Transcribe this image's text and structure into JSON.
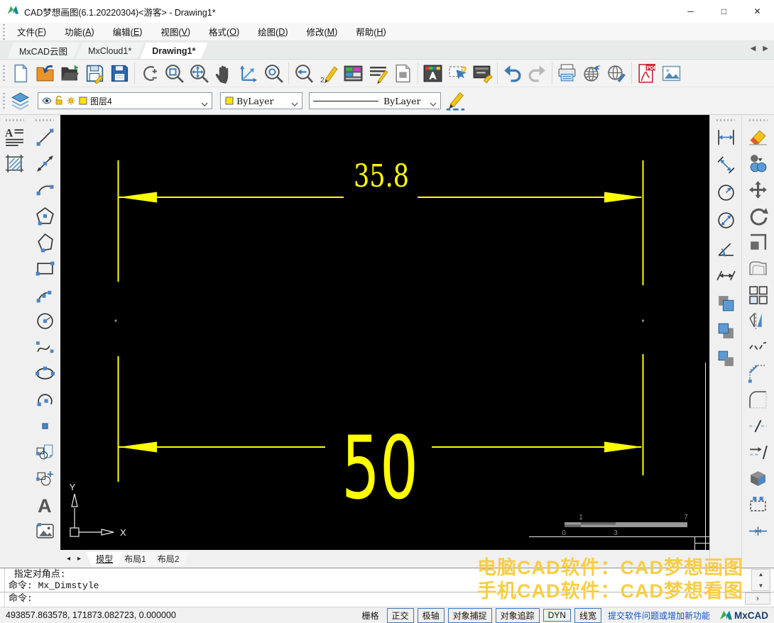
{
  "window": {
    "title": "CAD梦想画图(6.1.20220304)<游客> - Drawing1*",
    "minimize": "─",
    "maximize": "□",
    "close": "✕"
  },
  "menu": {
    "items": [
      "文件(F)",
      "功能(A)",
      "编辑(E)",
      "视图(V)",
      "格式(O)",
      "绘图(D)",
      "修改(M)",
      "帮助(H)"
    ]
  },
  "doc_tabs": {
    "tabs": [
      "MxCAD云图",
      "MxCloud1*",
      "Drawing1*"
    ],
    "active_index": 2,
    "scroll_left": "◀",
    "scroll_right": "▶"
  },
  "toolbar_main": {
    "icons": [
      "new-file",
      "open-dwg",
      "open-file",
      "save",
      "save-as",
      "zoom-scale",
      "zoom-window",
      "zoom-extents",
      "pan",
      "axes",
      "zoom-object",
      "zoom-previous",
      "draw-pencil",
      "layer-manager",
      "linetype-manager",
      "page-setup",
      "text-style",
      "selection-settings",
      "style-brush",
      "undo",
      "redo",
      "print",
      "publish-web",
      "web-edit",
      "export-pdf",
      "insert-image"
    ],
    "groups": "5,6,5,3,2,3,2"
  },
  "properties": {
    "layer": "图层4",
    "color": "ByLayer",
    "linetype": "ByLayer"
  },
  "left_toolbar": {
    "col1": [
      "mtext",
      "hatch"
    ],
    "col2": [
      "line",
      "xline",
      "arc",
      "polygon",
      "polyline",
      "rectangle",
      "pline-arc",
      "circle",
      "spline",
      "ellipse",
      "arc-cse",
      "point",
      "block",
      "insert-block",
      "text",
      "image-ref"
    ]
  },
  "right_toolbar": {
    "dim_icons": [
      "dim-linear",
      "dim-aligned",
      "dim-radius",
      "dim-diameter",
      "dim-angular",
      "dim-distance",
      "order-front",
      "order-back",
      "order-under"
    ],
    "modify_icons": [
      "erase",
      "copy",
      "move",
      "rotate",
      "scale",
      "offset",
      "array",
      "mirror",
      "revcloud",
      "chamfer",
      "fillet",
      "break",
      "lengthen",
      "box3d",
      "stretch",
      "join"
    ]
  },
  "canvas": {
    "dim_top": "35.8",
    "dim_bottom": "50",
    "ucs_x": "X",
    "ucs_y": "Y",
    "scalebar": {
      "above_left": "1",
      "above_right": "7",
      "below_left": "0",
      "below_mid": "3"
    }
  },
  "sheet_tabs": {
    "tabs": [
      "模型",
      "布局1",
      "布局2"
    ],
    "active_index": 0,
    "scroll_left": "◂",
    "scroll_right": "▸"
  },
  "command": {
    "history": [
      " 指定对角点:",
      "命令: Mx_Dimstyle"
    ],
    "prompt": "命令:"
  },
  "status": {
    "coords": "493857.863578, 171873.082723,  0.000000",
    "toggles": [
      {
        "label": "栅格",
        "bordered": false
      },
      {
        "label": "正交",
        "bordered": true
      },
      {
        "label": "极轴",
        "bordered": true
      },
      {
        "label": "对象捕捉",
        "bordered": true
      },
      {
        "label": "对象追踪",
        "bordered": true
      },
      {
        "label": "DYN",
        "bordered": true
      },
      {
        "label": "线宽",
        "bordered": true
      }
    ],
    "link": "提交软件问题或增加新功能",
    "brand": "MxCAD"
  },
  "watermark": {
    "line1": "电脑CAD软件：CAD梦想画图",
    "line2": "手机CAD软件：CAD梦想看图"
  },
  "colors": {
    "dim_yellow": "#ffff00",
    "watermark": "#f8ce45",
    "link_blue": "#1352c8",
    "canvas_bg": "#000000",
    "toggle_border": "#3c79bd"
  }
}
